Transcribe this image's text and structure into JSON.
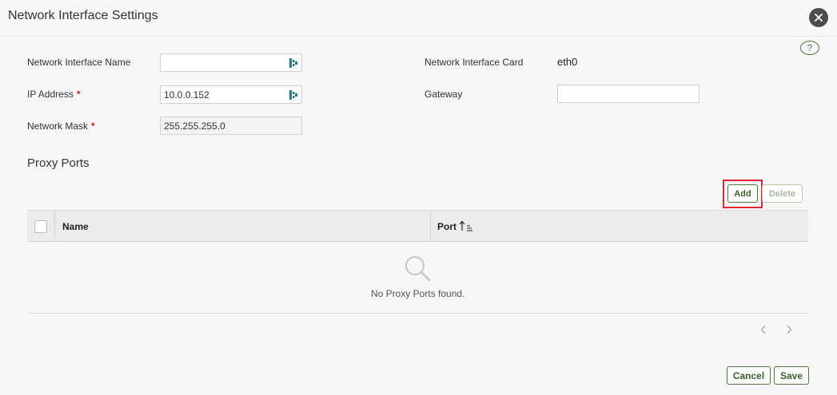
{
  "dialog": {
    "title": "Network Interface Settings",
    "close_icon": "close-icon",
    "help_label": "?"
  },
  "form": {
    "interface_name": {
      "label": "Network Interface Name",
      "value": ""
    },
    "ip_address": {
      "label": "IP Address",
      "required_mark": "*",
      "value": "10.0.0.152"
    },
    "network_mask": {
      "label": "Network Mask",
      "required_mark": "*",
      "value": "255.255.255.0"
    },
    "interface_card": {
      "label": "Network Interface Card",
      "value": "eth0"
    },
    "gateway": {
      "label": "Gateway",
      "value": ""
    }
  },
  "proxy_ports": {
    "section_title": "Proxy Ports",
    "add_label": "Add",
    "delete_label": "Delete",
    "columns": [
      "Name",
      "Port"
    ],
    "rows": [],
    "empty_message": "No Proxy Ports found."
  },
  "footer": {
    "cancel_label": "Cancel",
    "save_label": "Save"
  },
  "colors": {
    "accent_green": "#4f7a3b",
    "required_red": "#d0201b",
    "highlight_red": "#e0262a"
  }
}
